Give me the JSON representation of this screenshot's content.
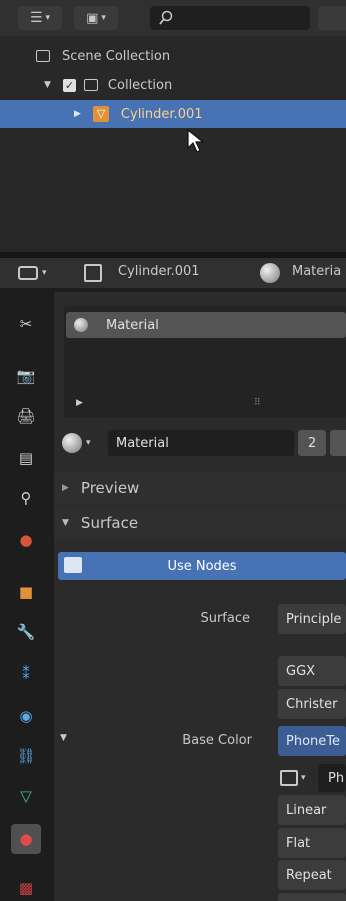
{
  "outliner": {
    "tree": [
      {
        "label": "Scene Collection"
      },
      {
        "label": "Collection"
      },
      {
        "label": "Cylinder.001"
      }
    ]
  },
  "properties": {
    "header": {
      "object_name": "Cylinder.001",
      "material_tab": "Materia"
    },
    "material_slot": "Material",
    "material_datablock": "Material",
    "user_count": "2",
    "panels": {
      "preview": "Preview",
      "surface": "Surface"
    },
    "use_nodes_label": "Use Nodes",
    "surface_label": "Surface",
    "surface_value": "Principle",
    "distribution": "GGX",
    "subsurface_method": "Christer",
    "base_color_label": "Base Color",
    "base_color_value": "PhoneTe",
    "image_value": "Ph",
    "interpolation": "Linear",
    "projection": "Flat",
    "extension": "Repeat"
  },
  "colors": {
    "selection": "#4772b3",
    "object_orange": "#e0913a",
    "header_bg": "#303030",
    "panel_bg": "#2b2b2b"
  }
}
